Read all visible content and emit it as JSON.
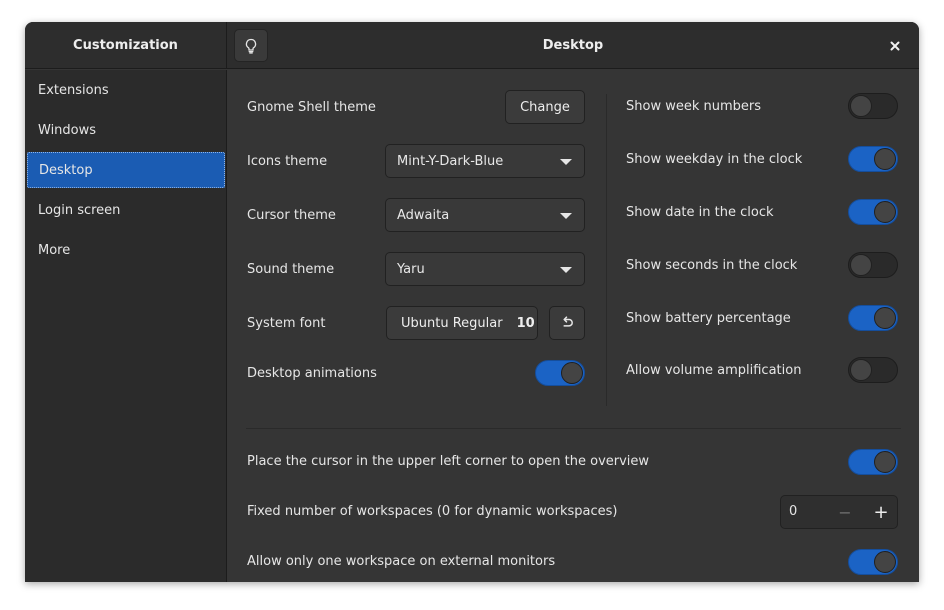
{
  "header": {
    "app_title": "Customization",
    "page_title": "Desktop"
  },
  "sidebar": {
    "items": [
      {
        "label": "Extensions"
      },
      {
        "label": "Windows"
      },
      {
        "label": "Desktop",
        "active": true
      },
      {
        "label": "Login screen"
      },
      {
        "label": "More"
      }
    ]
  },
  "left_settings": {
    "shell_theme": {
      "label": "Gnome Shell theme",
      "button": "Change"
    },
    "icons_theme": {
      "label": "Icons theme",
      "value": "Mint-Y-Dark-Blue"
    },
    "cursor_theme": {
      "label": "Cursor theme",
      "value": "Adwaita"
    },
    "sound_theme": {
      "label": "Sound theme",
      "value": "Yaru"
    },
    "system_font": {
      "label": "System font",
      "font_name": "Ubuntu Regular",
      "font_size": "10"
    },
    "desktop_animations": {
      "label": "Desktop animations",
      "enabled": true
    }
  },
  "right_settings": [
    {
      "label": "Show week numbers",
      "enabled": false
    },
    {
      "label": "Show weekday in the clock",
      "enabled": true
    },
    {
      "label": "Show date in the clock",
      "enabled": true
    },
    {
      "label": "Show seconds in the clock",
      "enabled": false
    },
    {
      "label": "Show battery percentage",
      "enabled": true
    },
    {
      "label": "Allow volume amplification",
      "enabled": false
    }
  ],
  "bottom_settings": {
    "hot_corner": {
      "label": "Place the cursor in the upper left corner to open the overview",
      "enabled": true
    },
    "workspaces": {
      "label": "Fixed number of workspaces (0 for dynamic workspaces)",
      "value": "0",
      "minus": "−",
      "plus": "+"
    },
    "one_workspace": {
      "label": "Allow only one workspace on external monitors",
      "enabled": true
    }
  },
  "colors": {
    "accent": "#1b63c5",
    "selection": "#1b5cb3",
    "background": "#353535",
    "sidebar": "#2b2b2b"
  },
  "icons": [
    "lightbulb-icon",
    "close-icon",
    "chevron-down-icon",
    "undo-icon"
  ]
}
